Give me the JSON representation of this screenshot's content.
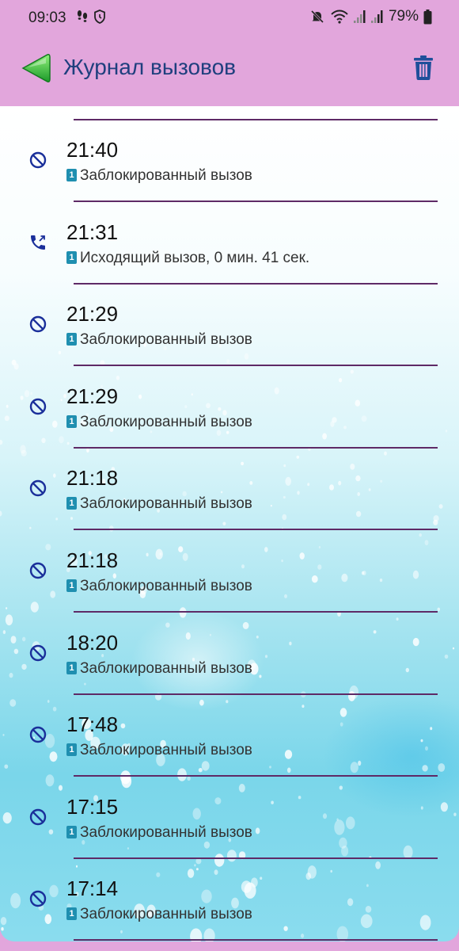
{
  "status_bar": {
    "time": "09:03",
    "battery": "79%",
    "left_icons": [
      "footsteps-icon",
      "shield-clock-icon"
    ],
    "right_icons": [
      "mute-icon",
      "wifi-icon",
      "signal-icon",
      "signal-icon",
      "battery-icon"
    ]
  },
  "app_bar": {
    "title": "Журнал вызовов",
    "back_icon": "back-arrow-icon",
    "delete_icon": "trash-icon"
  },
  "colors": {
    "app_bar": "#e2a6dc",
    "title": "#1f3f7e",
    "divider": "#5e2a66",
    "sim_badge": "#1f8fb0",
    "icon_blue": "#1a2f9a"
  },
  "calls": [
    {
      "time": "21:40",
      "sim": "1",
      "description": "Заблокированный вызов",
      "icon": "blocked-icon"
    },
    {
      "time": "21:31",
      "sim": "1",
      "description": "Исходящий вызов, 0 мин. 41 сек.",
      "icon": "outgoing-call-icon"
    },
    {
      "time": "21:29",
      "sim": "1",
      "description": "Заблокированный вызов",
      "icon": "blocked-icon"
    },
    {
      "time": "21:29",
      "sim": "1",
      "description": "Заблокированный вызов",
      "icon": "blocked-icon"
    },
    {
      "time": "21:18",
      "sim": "1",
      "description": "Заблокированный вызов",
      "icon": "blocked-icon"
    },
    {
      "time": "21:18",
      "sim": "1",
      "description": "Заблокированный вызов",
      "icon": "blocked-icon"
    },
    {
      "time": "18:20",
      "sim": "1",
      "description": "Заблокированный вызов",
      "icon": "blocked-icon"
    },
    {
      "time": "17:48",
      "sim": "1",
      "description": "Заблокированный вызов",
      "icon": "blocked-icon"
    },
    {
      "time": "17:15",
      "sim": "1",
      "description": "Заблокированный вызов",
      "icon": "blocked-icon"
    },
    {
      "time": "17:14",
      "sim": "1",
      "description": "Заблокированный вызов",
      "icon": "blocked-icon"
    }
  ]
}
